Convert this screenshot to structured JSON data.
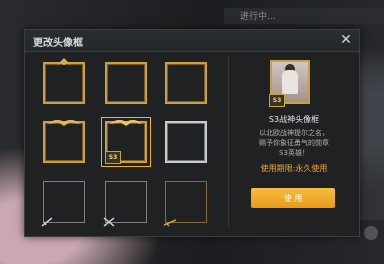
{
  "dialog": {
    "title": "更改头像框",
    "close_icon": "close-icon"
  },
  "frames": [
    {
      "style": "gold-ornate",
      "selected": false
    },
    {
      "style": "gold",
      "selected": false
    },
    {
      "style": "gold",
      "selected": false
    },
    {
      "style": "gold-winged",
      "selected": false
    },
    {
      "style": "gold-winged",
      "badge": "S3",
      "selected": true
    },
    {
      "style": "silver",
      "selected": false
    },
    {
      "style": "plain",
      "selected": false
    },
    {
      "style": "plain",
      "selected": false
    },
    {
      "style": "plain",
      "selected": false
    }
  ],
  "detail": {
    "preview_badge": "S3",
    "name": "S3战神头像框",
    "description_line1": "以北欧战神提尔之名，",
    "description_line2": "赐予你象征勇气的勋章",
    "description_line3": "S3英雄！",
    "period": "使用期限:永久使用",
    "use_button": "使 用"
  },
  "background": {
    "top_text": "进行中..."
  }
}
